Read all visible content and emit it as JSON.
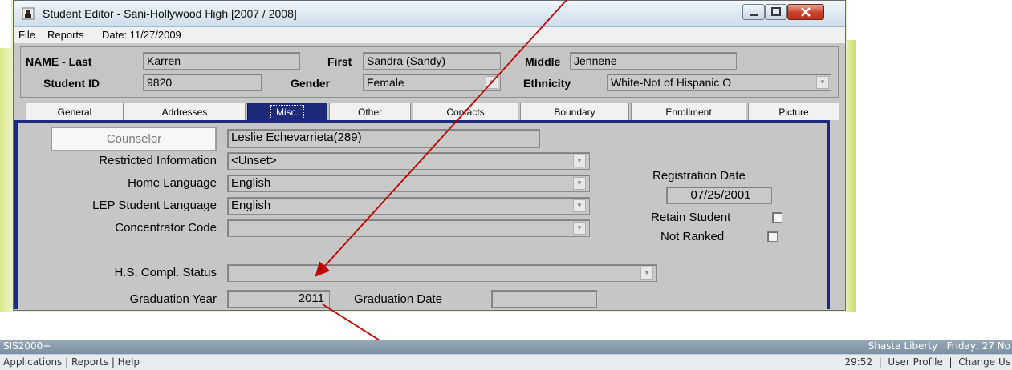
{
  "window": {
    "title": "Student Editor - Sani-Hollywood High [2007 / 2008]",
    "menu": [
      "File",
      "Reports",
      "Date: 11/27/2009"
    ]
  },
  "student": {
    "last_label": "NAME - Last",
    "last": "Karren",
    "first_label": "First",
    "first": "Sandra (Sandy)",
    "middle_label": "Middle",
    "middle": "Jennene",
    "id_label": "Student ID",
    "id": "9820",
    "gender_label": "Gender",
    "gender": "Female",
    "ethnicity_label": "Ethnicity",
    "ethnicity": "White-Not of Hispanic O"
  },
  "tabs": [
    "General",
    "Addresses",
    "Misc.",
    "Other",
    "Contacts",
    "Boundary",
    "Enrollment",
    "Picture"
  ],
  "misc": {
    "counselor_button": "Counselor",
    "counselor": "Leslie Echevarrieta(289)",
    "restricted_label": "Restricted Information",
    "restricted": "<Unset>",
    "home_lang_label": "Home Language",
    "home_lang": "English",
    "lep_label": "LEP Student Language",
    "lep": "English",
    "concentrator_label": "Concentrator Code",
    "concentrator": "",
    "hs_status_label": "H.S. Compl. Status",
    "hs_status": "",
    "grad_year_label": "Graduation Year",
    "grad_year": "2011",
    "grad_date_label": "Graduation Date",
    "grad_date": "",
    "reg_date_label": "Registration Date",
    "reg_date": "07/25/2001",
    "retain_label": "Retain Student",
    "not_ranked_label": "Not Ranked"
  },
  "bottom_bar": {
    "app": "SIS2000+",
    "right_info": "Shasta Liberty   Friday, 27 No",
    "nav": "Applications | Reports | Help",
    "right_nav": "29:52  |  User Profile  |  Change Us"
  },
  "colors": {
    "annotation_arrow": "#c00000",
    "active_tab": "#1d2a7a",
    "panel_border": "#1e2a82"
  }
}
